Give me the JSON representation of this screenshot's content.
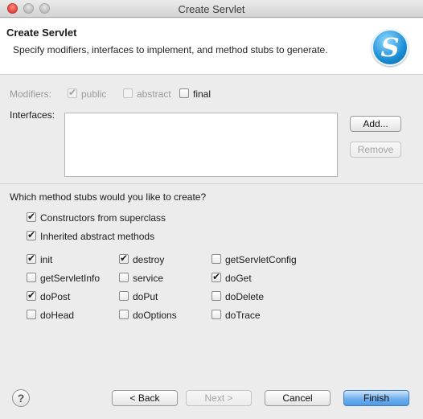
{
  "window": {
    "title": "Create Servlet"
  },
  "header": {
    "title": "Create Servlet",
    "description": "Specify modifiers, interfaces to implement, and method stubs to generate."
  },
  "modifiers": {
    "label": "Modifiers:",
    "public": {
      "label": "public",
      "checked": true,
      "enabled": false
    },
    "abstract": {
      "label": "abstract",
      "checked": false,
      "enabled": false
    },
    "final": {
      "label": "final",
      "checked": false,
      "enabled": true
    }
  },
  "interfaces": {
    "label": "Interfaces:",
    "add_button": "Add...",
    "remove_button": "Remove"
  },
  "stubs": {
    "question": "Which method stubs would you like to create?",
    "constructors": {
      "label": "Constructors from superclass",
      "checked": true
    },
    "inherited": {
      "label": "Inherited abstract methods",
      "checked": true
    },
    "methods": [
      {
        "label": "init",
        "checked": true
      },
      {
        "label": "destroy",
        "checked": true
      },
      {
        "label": "getServletConfig",
        "checked": false
      },
      {
        "label": "getServletInfo",
        "checked": false
      },
      {
        "label": "service",
        "checked": false
      },
      {
        "label": "doGet",
        "checked": true
      },
      {
        "label": "doPost",
        "checked": true
      },
      {
        "label": "doPut",
        "checked": false
      },
      {
        "label": "doDelete",
        "checked": false
      },
      {
        "label": "doHead",
        "checked": false
      },
      {
        "label": "doOptions",
        "checked": false
      },
      {
        "label": "doTrace",
        "checked": false
      }
    ]
  },
  "footer": {
    "help_glyph": "?",
    "back_button": "< Back",
    "next_button": "Next >",
    "cancel_button": "Cancel",
    "finish_button": "Finish"
  },
  "icons": {
    "logo": "servlet-s-logo-icon",
    "logo_glyph": "S"
  },
  "colors": {
    "primary_button": "#4f9ae6",
    "logo_blue": "#1b8ed6"
  }
}
